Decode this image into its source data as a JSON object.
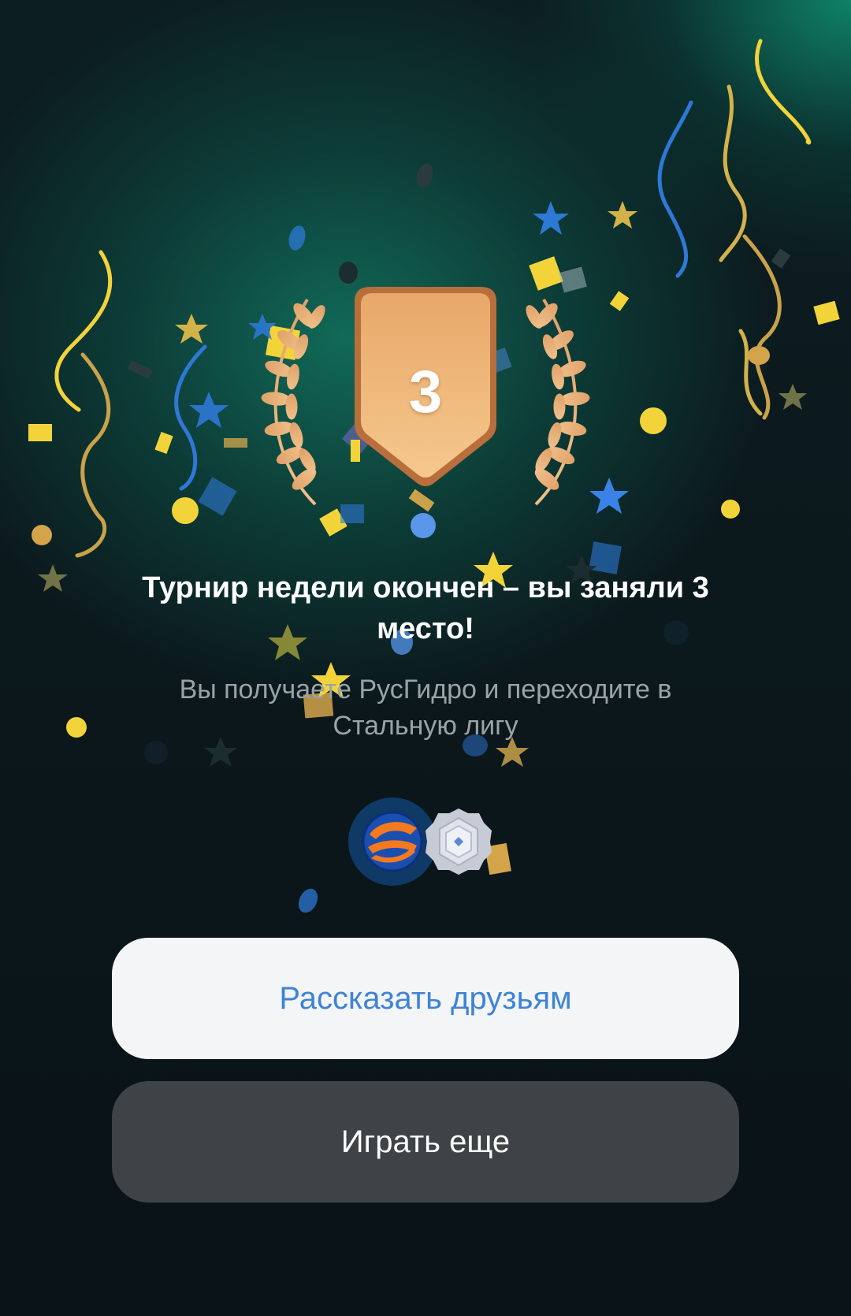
{
  "result": {
    "place": "3",
    "title": "Турнир недели окончен – вы заняли 3 место!",
    "subtitle": "Вы получаете РусГидро и переходите в Стальную лигу"
  },
  "rewards": [
    {
      "icon": "rushydro-token-icon"
    },
    {
      "icon": "steel-league-badge-icon"
    }
  ],
  "buttons": {
    "share_label": "Рассказать друзьям",
    "play_again_label": "Играть еще"
  },
  "colors": {
    "share_button_bg": "#f3f5f7",
    "share_button_text": "#3f83d6",
    "play_button_bg": "#3d4347",
    "play_button_text": "#ffffff",
    "medal_bronze": "#e0a169"
  }
}
